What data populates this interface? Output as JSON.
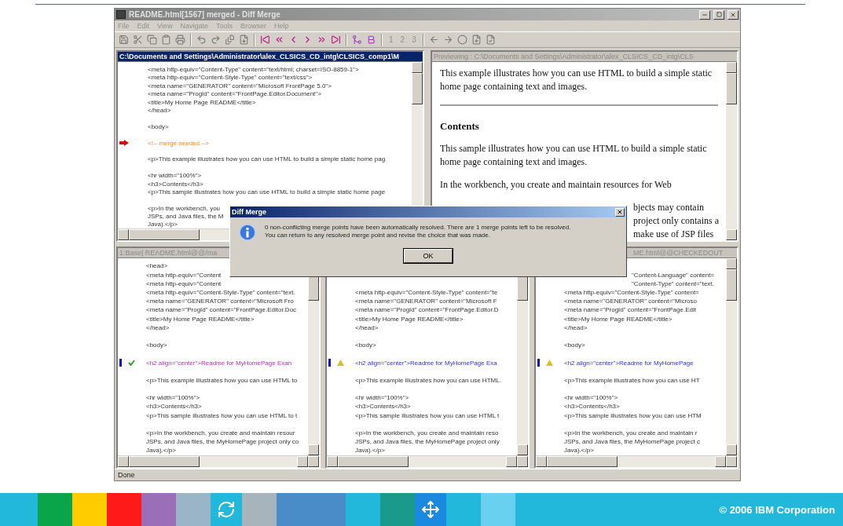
{
  "window": {
    "title": "README.html[1567] merged - Diff Merge",
    "menu": [
      "File",
      "Edit",
      "View",
      "Navigate",
      "Tools",
      "Browser",
      "Help"
    ],
    "toolbar_labels": [
      "1",
      "2",
      "3"
    ],
    "status": "Done"
  },
  "top_panes": [
    {
      "kind": "source",
      "active": true,
      "header": "C:\\Documents and Settings\\Administrator\\alex_CLSICS_CD_intg\\CLSICS_comp1\\M",
      "lines": [
        {
          "kind": "code",
          "text": "<meta http-equiv=\"Content-Type\" content=\"text/html; charset=ISO-8859-1\">"
        },
        {
          "kind": "code",
          "text": "<meta http-equiv=\"Content-Style-Type\" content=\"text/css\">"
        },
        {
          "kind": "code",
          "text": "<meta name=\"GENERATOR\" content=\"Microsoft FrontPage 5.0\">"
        },
        {
          "kind": "code",
          "text": "<meta name=\"ProgId\" content=\"FrontPage.Editor.Document\">"
        },
        {
          "kind": "code",
          "text": "<title>My Home Page README</title>"
        },
        {
          "kind": "code",
          "text": "</head>"
        },
        {
          "kind": "blank"
        },
        {
          "kind": "code",
          "text": "<body>"
        },
        {
          "kind": "blank"
        },
        {
          "kind": "conflict",
          "text": "<!-- merge needed -->"
        },
        {
          "kind": "blank"
        },
        {
          "kind": "code",
          "text": "<p>This example illustrates how you can use HTML to build a simple static home pag"
        },
        {
          "kind": "blank"
        },
        {
          "kind": "code",
          "text": "<hr width=\"100%\">"
        },
        {
          "kind": "code",
          "text": "<h3>Contents</h3>"
        },
        {
          "kind": "code",
          "text": "<p>This sample illustrates how you can use HTML to build a simple static home page"
        },
        {
          "kind": "blank"
        },
        {
          "kind": "code",
          "text": "<p>In the workbench, you"
        },
        {
          "kind": "code",
          "text": "JSPs, and Java files, the M"
        },
        {
          "kind": "code",
          "text": "Java).</p>"
        }
      ]
    },
    {
      "kind": "preview",
      "active": false,
      "header": "Previewing : C:\\Documents and Settings\\Administrator\\alex_CLSICS_CD_intg\\CLS",
      "blocks": [
        {
          "kind": "paragraph",
          "text": "This example illustrates how you can use HTML to build a simple static home page containing text and images."
        },
        {
          "kind": "rule"
        },
        {
          "kind": "heading",
          "text": "Contents"
        },
        {
          "kind": "paragraph",
          "text": "This sample illustrates how you can use HTML to build a simple static home page containing text and images."
        },
        {
          "kind": "paragraph",
          "text": "In the workbench, you create and maintain resources for Web"
        },
        {
          "kind": "clipped",
          "text": "bjects may contain"
        },
        {
          "kind": "clipped",
          "text": "project only contains a"
        },
        {
          "kind": "clipped",
          "text": "make use of JSP files"
        }
      ]
    }
  ],
  "bottom_panes": [
    {
      "active": false,
      "header_clipped": false,
      "header": "1:Base| README.html@@/ma",
      "lines": [
        {
          "kind": "code",
          "text": "<head>"
        },
        {
          "kind": "code",
          "text": "<meta http-equiv=\"Content"
        },
        {
          "kind": "code",
          "text": "<meta http-equiv=\"Content"
        },
        {
          "kind": "code",
          "text": "<meta http-equiv=\"Content-Style-Type\" content=\"text."
        },
        {
          "kind": "code",
          "text": "<meta name=\"GENERATOR\" content=\"Microsoft Fro"
        },
        {
          "kind": "code",
          "text": "<meta name=\"ProgId\" content=\"FrontPage.Editor.Doc"
        },
        {
          "kind": "code",
          "text": "<title>My Home Page README</title>"
        },
        {
          "kind": "code",
          "text": "</head>"
        },
        {
          "kind": "blank"
        },
        {
          "kind": "code",
          "text": "<body>"
        },
        {
          "kind": "blank"
        },
        {
          "kind": "resolved",
          "text": "<h2 align=\"center\">Readme for MyHomePage Exan"
        },
        {
          "kind": "blank"
        },
        {
          "kind": "code",
          "text": "<p>This example illustrates how you can use HTML to"
        },
        {
          "kind": "blank"
        },
        {
          "kind": "code",
          "text": "<hr width=\"100%\">"
        },
        {
          "kind": "code",
          "text": "<h3>Contents</h3>"
        },
        {
          "kind": "code",
          "text": "<p>This sample illustrates how you can use HTML to t"
        },
        {
          "kind": "blank"
        },
        {
          "kind": "code",
          "text": "<p>In the workbench, you create and maintain resour"
        },
        {
          "kind": "code",
          "text": "JSPs, and Java files, the MyHomePage project only co"
        },
        {
          "kind": "code",
          "text": "Java).</p>"
        }
      ]
    },
    {
      "lines": [
        {
          "kind": "blank"
        },
        {
          "kind": "blank"
        },
        {
          "kind": "blank"
        },
        {
          "kind": "code",
          "text": "<meta http-equiv=\"Content-Style-Type\" content=\"te"
        },
        {
          "kind": "code",
          "text": "<meta name=\"GENERATOR\" content=\"Microsoft F"
        },
        {
          "kind": "code",
          "text": "<meta name=\"ProgId\" content=\"FrontPage.Editor.D"
        },
        {
          "kind": "code",
          "text": "<title>My Home Page README</title>"
        },
        {
          "kind": "code",
          "text": "</head>"
        },
        {
          "kind": "blank"
        },
        {
          "kind": "code",
          "text": "<body>"
        },
        {
          "kind": "blank"
        },
        {
          "kind": "pending",
          "text": "<h2 align=\"center\">Readme for MyHomePage Exa"
        },
        {
          "kind": "blank"
        },
        {
          "kind": "code",
          "text": "<p>This example illustrates how you can use HTML."
        },
        {
          "kind": "blank"
        },
        {
          "kind": "code",
          "text": "<hr width=\"100%\">"
        },
        {
          "kind": "code",
          "text": "<h3>Contents</h3>"
        },
        {
          "kind": "code",
          "text": "<p>This sample illustrates how you can use HTML t"
        },
        {
          "kind": "blank"
        },
        {
          "kind": "code",
          "text": "<p>In the workbench, you create and maintain reso"
        },
        {
          "kind": "code",
          "text": "JSPs, and Java files, the MyHomePage project only"
        },
        {
          "kind": "code",
          "text": "Java).</p>"
        }
      ]
    },
    {
      "active": false,
      "header_clipped": true,
      "header": "ME.html@@CHECKEDOUT",
      "lines": [
        {
          "kind": "blank"
        },
        {
          "kind": "clipped",
          "text": "\"Content-Language\" content="
        },
        {
          "kind": "clipped",
          "text": "\"Content-Type\" content=\"text."
        },
        {
          "kind": "code",
          "text": "<meta http-equiv=\"Content-Style-Type\" content="
        },
        {
          "kind": "code",
          "text": "<meta name=\"GENERATOR\" content=\"Microso"
        },
        {
          "kind": "code",
          "text": "<meta name=\"ProgId\" content=\"FrontPage.Edit"
        },
        {
          "kind": "code",
          "text": "<title>My Home Page README</title>"
        },
        {
          "kind": "code",
          "text": "</head>"
        },
        {
          "kind": "blank"
        },
        {
          "kind": "code",
          "text": "<body>"
        },
        {
          "kind": "blank"
        },
        {
          "kind": "pending",
          "text": "<h2 align=\"center\">Readme for MyHomePage"
        },
        {
          "kind": "blank"
        },
        {
          "kind": "code",
          "text": "<p>This example illustrates how you can use HT"
        },
        {
          "kind": "blank"
        },
        {
          "kind": "code",
          "text": "<hr width=\"100%\">"
        },
        {
          "kind": "code",
          "text": "<h3>Contents</h3>"
        },
        {
          "kind": "code",
          "text": "<p>This sample illustrates how you can use HTM"
        },
        {
          "kind": "blank"
        },
        {
          "kind": "code",
          "text": "<p>In the workbench, you create and maintain r"
        },
        {
          "kind": "code",
          "text": "JSPs, and Java files, the MyHomePage project c"
        },
        {
          "kind": "code",
          "text": "Java).</p>"
        }
      ]
    }
  ],
  "dialog": {
    "title": "Diff Merge",
    "message_lines": [
      "0 non-conflicting merge points have been automatically resolved.  There are 1 merge points left to be resolved.",
      "You can return to any resolved merge point and revise the choice that was made."
    ],
    "button": "OK"
  },
  "slide": {
    "copyright": "© 2006 IBM Corporation"
  }
}
